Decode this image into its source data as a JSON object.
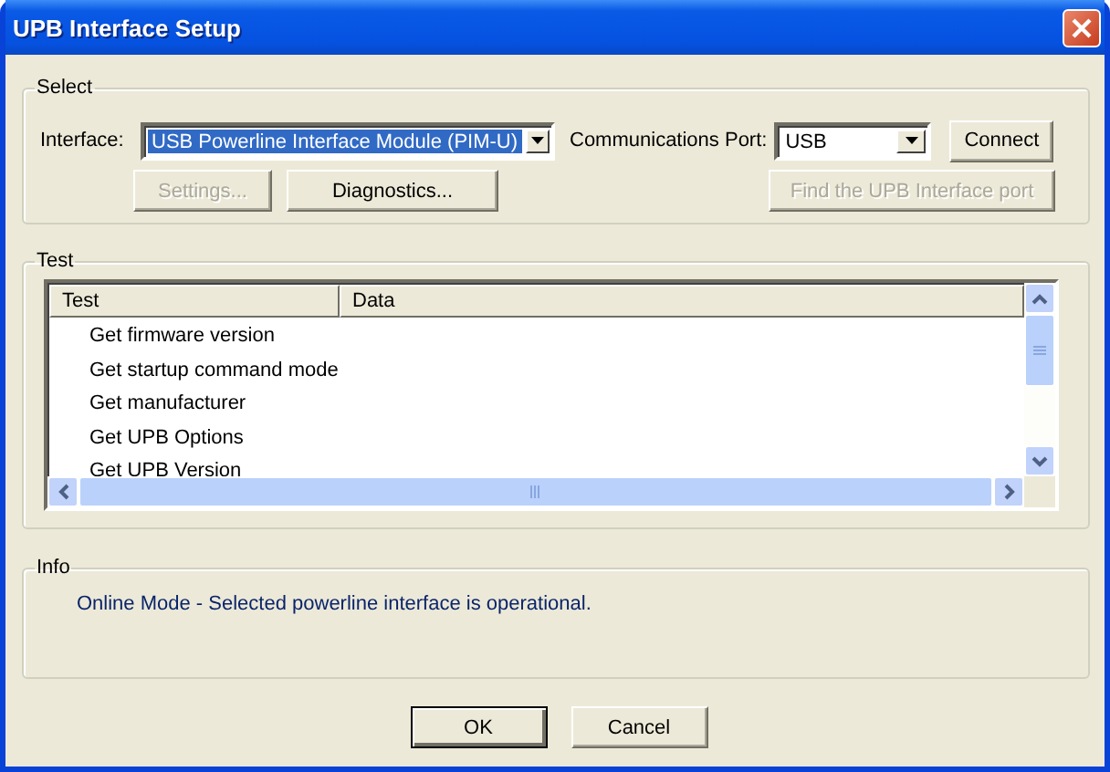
{
  "window": {
    "title": "UPB Interface Setup"
  },
  "select_group": {
    "title": "Select",
    "interface_label": "Interface:",
    "interface_value": "USB Powerline Interface Module (PIM-U)",
    "interface_focused": true,
    "port_label": "Communications Port:",
    "port_value": "USB",
    "connect_button": {
      "label": "Connect",
      "disabled": false
    },
    "settings_button": {
      "label": "Settings...",
      "disabled": true
    },
    "diagnostics_button": {
      "label": "Diagnostics...",
      "disabled": false
    },
    "find_port_button": {
      "label": "Find the UPB Interface port",
      "disabled": true
    }
  },
  "test_group": {
    "title": "Test",
    "columns": [
      "Test",
      "Data"
    ],
    "rows": [
      "Get firmware version",
      "Get startup command mode",
      "Get manufacturer",
      "Get UPB Options",
      "Get UPB Version"
    ]
  },
  "info_group": {
    "title": "Info",
    "message": "Online Mode - Selected powerline interface is operational."
  },
  "dialog_buttons": [
    {
      "label": "OK",
      "default": true
    },
    {
      "label": "Cancel",
      "default": false
    }
  ]
}
